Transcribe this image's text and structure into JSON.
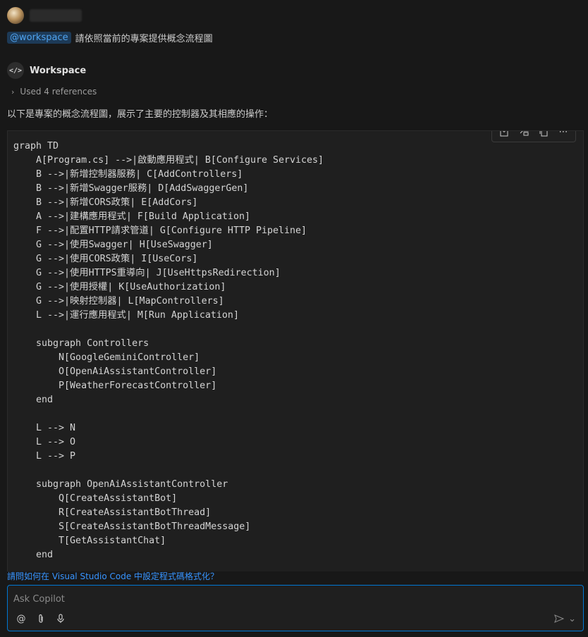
{
  "user": {
    "mention": "@workspace",
    "message": "請依照當前的專案提供概念流程圖"
  },
  "agent": {
    "icon": "code-bracket-icon",
    "name": "Workspace"
  },
  "references": {
    "label": "Used 4 references"
  },
  "intro": "以下是專案的概念流程圖，展示了主要的控制器及其相應的操作：",
  "code": {
    "lines": [
      "graph TD",
      "    A[Program.cs] -->|啟動應用程式| B[Configure Services]",
      "    B -->|新增控制器服務| C[AddControllers]",
      "    B -->|新增Swagger服務| D[AddSwaggerGen]",
      "    B -->|新增CORS政策| E[AddCors]",
      "    A -->|建構應用程式| F[Build Application]",
      "    F -->|配置HTTP請求管道| G[Configure HTTP Pipeline]",
      "    G -->|使用Swagger| H[UseSwagger]",
      "    G -->|使用CORS政策| I[UseCors]",
      "    G -->|使用HTTPS重導向| J[UseHttpsRedirection]",
      "    G -->|使用授權| K[UseAuthorization]",
      "    G -->|映射控制器| L[MapControllers]",
      "    L -->|運行應用程式| M[Run Application]",
      "",
      "    subgraph Controllers",
      "        N[GoogleGeminiController]",
      "        O[OpenAiAssistantController]",
      "        P[WeatherForecastController]",
      "    end",
      "",
      "    L --> N",
      "    L --> O",
      "    L --> P",
      "",
      "    subgraph OpenAiAssistantController",
      "        Q[CreateAssistantBot]",
      "        R[CreateAssistantBotThread]",
      "        S[CreateAssistantBotThreadMessage]",
      "        T[GetAssistantChat]",
      "    end"
    ]
  },
  "toolbar": {
    "icons": [
      "insert-at-cursor-icon",
      "insert-into-new-file-icon",
      "copy-icon",
      "more-icon"
    ]
  },
  "followup": "請問如何在 Visual Studio Code 中設定程式碼格式化？",
  "input": {
    "placeholder": "Ask Copilot"
  },
  "input_tools": [
    "at-mention-icon",
    "attach-icon",
    "microphone-icon"
  ],
  "colors": {
    "accent": "#0078d4",
    "link": "#3794ff",
    "mention_bg": "#1d3a57",
    "background": "#181818"
  }
}
